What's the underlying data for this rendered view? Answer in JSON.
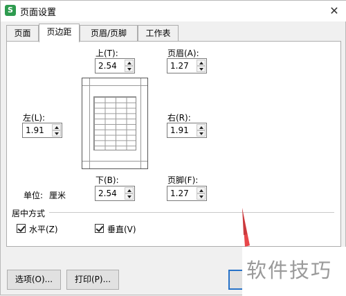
{
  "window": {
    "title": "页面设置",
    "app_icon_letter": "S",
    "close_glyph": "✕"
  },
  "tabs": [
    {
      "label": "页面",
      "active": false
    },
    {
      "label": "页边距",
      "active": true
    },
    {
      "label": "页眉/页脚",
      "active": false
    },
    {
      "label": "工作表",
      "active": false
    }
  ],
  "margins": {
    "top": {
      "label": "上(T):",
      "value": "2.54"
    },
    "header": {
      "label": "页眉(A):",
      "value": "1.27"
    },
    "left": {
      "label": "左(L):",
      "value": "1.91"
    },
    "right": {
      "label": "右(R):",
      "value": "1.91"
    },
    "bottom": {
      "label": "下(B):",
      "value": "2.54"
    },
    "footer": {
      "label": "页脚(F):",
      "value": "1.27"
    }
  },
  "unit": {
    "label": "单位:",
    "value": "厘米"
  },
  "center_on_page": {
    "group_label": "居中方式",
    "horizontal": {
      "label": "水平(Z)",
      "checked": true
    },
    "vertical": {
      "label": "垂直(V)",
      "checked": true
    }
  },
  "buttons": {
    "options": "选项(O)...",
    "print": "打印(P)..."
  },
  "watermark": {
    "text": "软件技巧",
    "arrow_color": "#e8474a"
  }
}
